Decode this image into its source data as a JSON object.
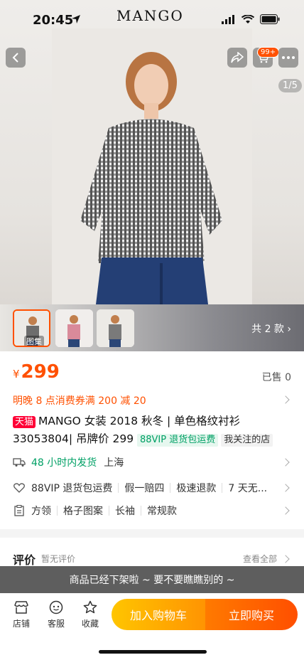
{
  "status": {
    "time": "20:45",
    "brand": "MANGO"
  },
  "header": {
    "cart_badge": "99+",
    "image_counter": "1/5"
  },
  "gallery": {
    "thumb_label": "图集",
    "total_label": "共 2 款"
  },
  "product": {
    "currency": "¥",
    "price": "299",
    "sold": "已售 0",
    "promo": "明晚 8 点消费券满 200 减 20",
    "tmall_badge": "天猫",
    "title": "MANGO 女装 2018 秋冬 | 单色格纹衬衫 33053804| 吊牌价 299",
    "tag_vip": "88VIP 退货包运费",
    "tag_fav": "我关注的店"
  },
  "shipping": {
    "time": "48 小时内发货",
    "location": "上海"
  },
  "service": {
    "items": [
      "88VIP 退货包运费",
      "假一赔四",
      "极速退款",
      "7 天无..."
    ]
  },
  "specs": {
    "items": [
      "方领",
      "格子图案",
      "长袖",
      "常规款"
    ]
  },
  "review": {
    "title": "评价",
    "subtitle": "暂无评价",
    "view_all": "查看全部"
  },
  "toast": "商品已经下架啦 ~ 要不要瞧瞧别的 ~",
  "bottom": {
    "store": "店铺",
    "service": "客服",
    "favorite": "收藏",
    "add_cart": "加入购物车",
    "buy_now": "立即购买"
  },
  "colors": {
    "accent": "#ff5000",
    "tmall": "#ff0036",
    "green": "#00a065"
  }
}
